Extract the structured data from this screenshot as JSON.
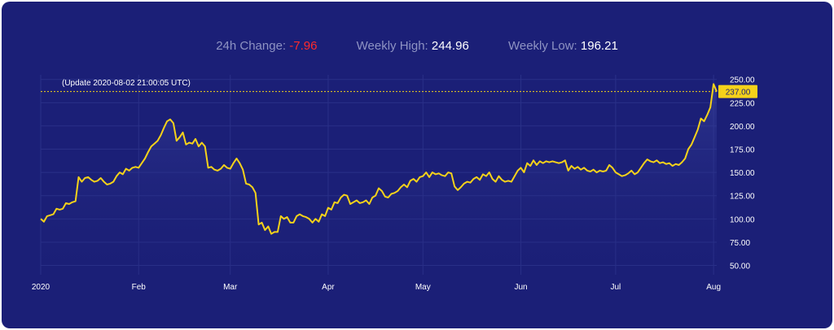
{
  "stats": {
    "change_label": "24h Change:",
    "change_value": "-7.96",
    "high_label": "Weekly High:",
    "high_value": "244.96",
    "low_label": "Weekly Low:",
    "low_value": "196.21"
  },
  "colors": {
    "background": "#1b1f77",
    "line": "#f5d21a",
    "negative": "#ff2a2a",
    "grid": "#2a3088"
  },
  "chart_data": {
    "type": "area",
    "update_text": "(Update 2020-08-02 21:00:05 UTC)",
    "current_price": 237.0,
    "current_price_label": "237.00",
    "ylim": [
      40,
      255
    ],
    "y_ticks": [
      50,
      75,
      100,
      125,
      150,
      175,
      200,
      225,
      250
    ],
    "y_tick_labels": [
      "50.00",
      "75.00",
      "100.00",
      "125.00",
      "150.00",
      "175.00",
      "200.00",
      "225.00",
      "250.00"
    ],
    "x_tick_labels": [
      "2020",
      "Feb",
      "Mar",
      "Apr",
      "May",
      "Jun",
      "Jul",
      "Aug"
    ],
    "x_tick_days": [
      0,
      31,
      60,
      91,
      121,
      152,
      182,
      213
    ],
    "grid": true,
    "x_days": [
      0,
      1,
      2,
      3,
      4,
      5,
      6,
      7,
      8,
      9,
      10,
      11,
      12,
      13,
      14,
      15,
      16,
      17,
      18,
      19,
      20,
      21,
      22,
      23,
      24,
      25,
      26,
      27,
      28,
      29,
      30,
      31,
      32,
      33,
      34,
      35,
      36,
      37,
      38,
      39,
      40,
      41,
      42,
      43,
      44,
      45,
      46,
      47,
      48,
      49,
      50,
      51,
      52,
      53,
      54,
      55,
      56,
      57,
      58,
      59,
      60,
      61,
      62,
      63,
      64,
      65,
      66,
      67,
      68,
      69,
      70,
      71,
      72,
      73,
      74,
      75,
      76,
      77,
      78,
      79,
      80,
      81,
      82,
      83,
      84,
      85,
      86,
      87,
      88,
      89,
      90,
      91,
      92,
      93,
      94,
      95,
      96,
      97,
      98,
      99,
      100,
      101,
      102,
      103,
      104,
      105,
      106,
      107,
      108,
      109,
      110,
      111,
      112,
      113,
      114,
      115,
      116,
      117,
      118,
      119,
      120,
      121,
      122,
      123,
      124,
      125,
      126,
      127,
      128,
      129,
      130,
      131,
      132,
      133,
      134,
      135,
      136,
      137,
      138,
      139,
      140,
      141,
      142,
      143,
      144,
      145,
      146,
      147,
      148,
      149,
      150,
      151,
      152,
      153,
      154,
      155,
      156,
      157,
      158,
      159,
      160,
      161,
      162,
      163,
      164,
      165,
      166,
      167,
      168,
      169,
      170,
      171,
      172,
      173,
      174,
      175,
      176,
      177,
      178,
      179,
      180,
      181,
      182,
      183,
      184,
      185,
      186,
      187,
      188,
      189,
      190,
      191,
      192,
      193,
      194,
      195,
      196,
      197,
      198,
      199,
      200,
      201,
      202,
      203,
      204,
      205,
      206,
      207,
      208,
      209,
      210,
      211,
      212,
      213,
      214
    ],
    "values": [
      100,
      97,
      103,
      104,
      105,
      111,
      110,
      111,
      117,
      116,
      118,
      119,
      145,
      140,
      144,
      145,
      142,
      140,
      141,
      144,
      140,
      137,
      138,
      140,
      146,
      150,
      148,
      154,
      152,
      155,
      156,
      155,
      160,
      165,
      172,
      178,
      181,
      184,
      190,
      198,
      205,
      207,
      203,
      184,
      188,
      193,
      180,
      182,
      181,
      186,
      178,
      182,
      178,
      155,
      156,
      153,
      152,
      154,
      158,
      155,
      154,
      160,
      165,
      160,
      153,
      138,
      137,
      134,
      128,
      94,
      96,
      88,
      92,
      84,
      86,
      86,
      103,
      100,
      102,
      96,
      96,
      103,
      105,
      103,
      102,
      100,
      96,
      100,
      97,
      105,
      103,
      112,
      110,
      118,
      117,
      123,
      126,
      125,
      116,
      118,
      120,
      117,
      118,
      120,
      116,
      123,
      125,
      133,
      130,
      124,
      123,
      127,
      128,
      130,
      134,
      137,
      134,
      141,
      143,
      140,
      145,
      146,
      150,
      145,
      150,
      148,
      149,
      147,
      146,
      150,
      149,
      135,
      131,
      134,
      138,
      140,
      139,
      143,
      145,
      142,
      148,
      146,
      150,
      143,
      140,
      146,
      142,
      140,
      141,
      140,
      146,
      152,
      155,
      150,
      160,
      157,
      163,
      158,
      162,
      160,
      162,
      161,
      162,
      161,
      160,
      161,
      163,
      152,
      157,
      154,
      156,
      153,
      155,
      152,
      151,
      153,
      150,
      152,
      151,
      152,
      158,
      155,
      150,
      148,
      146,
      147,
      149,
      152,
      148,
      150,
      155,
      160,
      164,
      162,
      161,
      163,
      160,
      161,
      159,
      160,
      157,
      159,
      158,
      161,
      165,
      175,
      180,
      188,
      196,
      208,
      205,
      212,
      220,
      245,
      237
    ]
  }
}
